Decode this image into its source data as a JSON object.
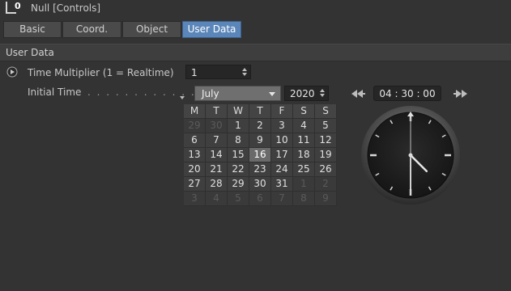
{
  "window": {
    "title": "Null [Controls]",
    "icon": "null-object-icon"
  },
  "tabs": [
    {
      "label": "Basic",
      "active": false
    },
    {
      "label": "Coord.",
      "active": false
    },
    {
      "label": "Object",
      "active": false
    },
    {
      "label": "User Data",
      "active": true
    }
  ],
  "section": {
    "title": "User Data"
  },
  "params": {
    "time_multiplier": {
      "label": "Time Multiplier (1 = Realtime)",
      "value": "1"
    },
    "initial_time": {
      "label": "Initial Time",
      "dots": ". . . . . . . . . . . . . .",
      "month": "July",
      "year": "2020",
      "time": "04 : 30 : 00"
    }
  },
  "calendar": {
    "weekday_headers": [
      "M",
      "T",
      "W",
      "T",
      "F",
      "S",
      "S"
    ],
    "weeks": [
      [
        [
          "29",
          true
        ],
        [
          "30",
          true
        ],
        [
          "1",
          false
        ],
        [
          "2",
          false
        ],
        [
          "3",
          false
        ],
        [
          "4",
          false
        ],
        [
          "5",
          false
        ]
      ],
      [
        [
          "6",
          false
        ],
        [
          "7",
          false
        ],
        [
          "8",
          false
        ],
        [
          "9",
          false
        ],
        [
          "10",
          false
        ],
        [
          "11",
          false
        ],
        [
          "12",
          false
        ]
      ],
      [
        [
          "13",
          false
        ],
        [
          "14",
          false
        ],
        [
          "15",
          false
        ],
        [
          "16",
          false
        ],
        [
          "17",
          false
        ],
        [
          "18",
          false
        ],
        [
          "19",
          false
        ]
      ],
      [
        [
          "20",
          false
        ],
        [
          "21",
          false
        ],
        [
          "22",
          false
        ],
        [
          "23",
          false
        ],
        [
          "24",
          false
        ],
        [
          "25",
          false
        ],
        [
          "26",
          false
        ]
      ],
      [
        [
          "27",
          false
        ],
        [
          "28",
          false
        ],
        [
          "29",
          false
        ],
        [
          "30",
          false
        ],
        [
          "31",
          false
        ],
        [
          "1",
          true
        ],
        [
          "2",
          true
        ]
      ],
      [
        [
          "3",
          true
        ],
        [
          "4",
          true
        ],
        [
          "5",
          true
        ],
        [
          "6",
          true
        ],
        [
          "7",
          true
        ],
        [
          "8",
          true
        ],
        [
          "9",
          true
        ]
      ]
    ],
    "selected_day": "16"
  },
  "clock": {
    "hours": 4,
    "minutes": 30,
    "seconds": 0
  },
  "colors": {
    "accent": "#5b86b9",
    "background": "#333333",
    "field": "#262626"
  }
}
